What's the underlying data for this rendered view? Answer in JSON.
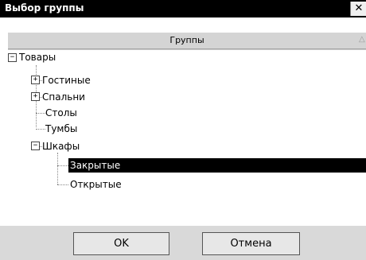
{
  "window": {
    "title": "Выбор группы",
    "close_glyph": "✕"
  },
  "tree_header": {
    "label": "Группы",
    "sort_glyph": "△"
  },
  "tree": [
    {
      "label": "Товары",
      "expander": "−"
    },
    {
      "label": "Гостиные",
      "expander": "+"
    },
    {
      "label": "Спальни",
      "expander": "+"
    },
    {
      "label": "Столы"
    },
    {
      "label": "Тумбы"
    },
    {
      "label": "Шкафы",
      "expander": "−"
    },
    {
      "label": "Закрытые",
      "selected": true
    },
    {
      "label": "Открытые"
    }
  ],
  "buttons": {
    "ok": "OK",
    "cancel": "Отмена"
  }
}
